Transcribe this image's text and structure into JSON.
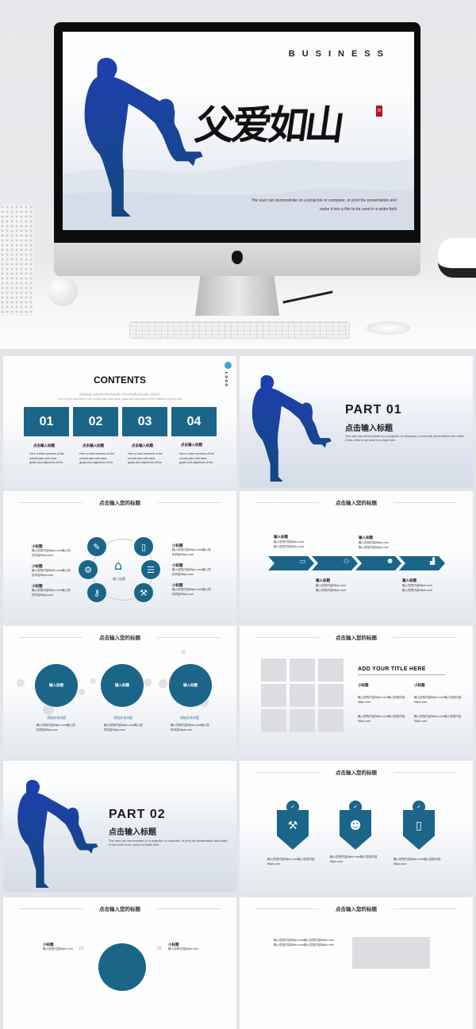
{
  "colors": {
    "accent": "#1b6589",
    "silhouette_top": "#1f3fb0",
    "silhouette_bottom": "#13487f",
    "seal": "#b3141b"
  },
  "hero": {
    "brand": "BUSINESS",
    "title": "父爱如山",
    "seal": "印",
    "desc_line1": "The user can demonstrate on a projector or computer, or print the presentation and",
    "desc_line2": "make it into a film to be used in a wider field",
    "apple_icon": "apple-logo"
  },
  "header_title": "点击输入您的标题",
  "contents": {
    "title": "CONTENTS",
    "logo": "LOGO",
    "sub_cn": "点击此处输入您的文字内容点击此处输入您的文字内容点击此处输入您的文字",
    "sub_en": "Here a brief overview of the overall plan with clear goals and objectives of the Platform and the like.",
    "items": [
      {
        "num": "01",
        "title": "点击输入标题",
        "desc": "Here a brief overview of the overall plan with clear goals and objectives of the"
      },
      {
        "num": "02",
        "title": "点击输入标题",
        "desc": "Here a brief overview of the overall plan with clear goals and objectives of the"
      },
      {
        "num": "03",
        "title": "点击输入标题",
        "desc": "Here a brief overview of the overall plan with clear goals and objectives of the"
      },
      {
        "num": "04",
        "title": "点击输入标题",
        "desc": "Here a brief overview of the overall plan with clear goals and objectives of the"
      }
    ]
  },
  "part1": {
    "title": "PART 01",
    "subtitle": "点击输入标题",
    "desc": "The user can demonstrate on a projector or computer, or print the presentation and make it into a film to be used in a wider field"
  },
  "part2": {
    "title": "PART 02",
    "subtitle": "点击输入标题",
    "desc": "The user can demonstrate on a projector or computer, or print the presentation and make it into a film to be used in a wider field"
  },
  "cycle": {
    "center": "输入标题",
    "items": [
      {
        "title": "小标题",
        "text": "输入您的内容58pic.com输入您的内容58pic.com"
      },
      {
        "title": "小标题",
        "text": "输入您的内容58pic.com输入您的内容58pic.com"
      },
      {
        "title": "小标题",
        "text": "输入您的内容58pic.com输入您的内容58pic.com"
      },
      {
        "title": "小标题",
        "text": "输入您的内容58pic.com输入您的内容58pic.com"
      },
      {
        "title": "小标题",
        "text": "输入您的内容58pic.com输入您的内容58pic.com"
      },
      {
        "title": "小标题",
        "text": "输入您的内容58pic.com输入您的内容58pic.com"
      }
    ],
    "icons": [
      "edit-icon",
      "devices-icon",
      "gear-icon",
      "database-icon",
      "key-icon",
      "wrench-icon"
    ]
  },
  "process": {
    "steps": [
      {
        "title": "输入标题",
        "text": "输入您的内容58pic.com输入您的内容58pic.com",
        "icon": "monitor-icon"
      },
      {
        "title": "输入标题",
        "text": "输入您的内容58pic.com输入您的内容58pic.com",
        "icon": "gamepad-icon"
      },
      {
        "title": "输入标题",
        "text": "输入您的内容58pic.com输入您的内容58pic.com",
        "icon": "team-icon"
      },
      {
        "title": "输入标题",
        "text": "输入您的内容58pic.com输入您的内容58pic.com",
        "icon": "chart-icon"
      }
    ]
  },
  "circles": {
    "items": [
      {
        "label": "输入标题",
        "caption": "添加文本内容",
        "text": "输入您的内容58pic.com输入您的内容58pic.com"
      },
      {
        "label": "输入标题",
        "caption": "添加文本内容",
        "text": "输入您的内容58pic.com输入您的内容58pic.com"
      },
      {
        "label": "输入标题",
        "caption": "添加文本内容",
        "text": "输入您的内容58pic.com输入您的内容58pic.com"
      }
    ]
  },
  "gallery": {
    "title": "ADD YOUR TITLE HERE",
    "cols": [
      {
        "title": "小标题",
        "text1": "输入您的内容58pic.com输入您的内容58pic.com",
        "text2": "输入您的内容58pic.com输入您的内容58pic.com"
      },
      {
        "title": "小标题",
        "text1": "输入您的内容58pic.com输入您的内容58pic.com",
        "text2": "输入您的内容58pic.com输入您的内容58pic.com"
      }
    ]
  },
  "shields": {
    "items": [
      {
        "icon": "tools-icon",
        "text": "输入您的内容58pic.com输入您的内容58pic.com"
      },
      {
        "icon": "user-icon",
        "text": "输入您的内容58pic.com输入您的内容58pic.com"
      },
      {
        "icon": "mobile-payment-icon",
        "text": "输入您的内容58pic.com输入您的内容58pic.com"
      }
    ]
  },
  "partial": {
    "left_title": "小标题",
    "left_text": "输入您的内容58pic.com",
    "left_num": "01",
    "right_num": "02",
    "right_title": "小标题",
    "right_text": "输入您的内容58pic.com",
    "list_line": "输入您的内容58pic.com输入您的内容58pic.com"
  }
}
